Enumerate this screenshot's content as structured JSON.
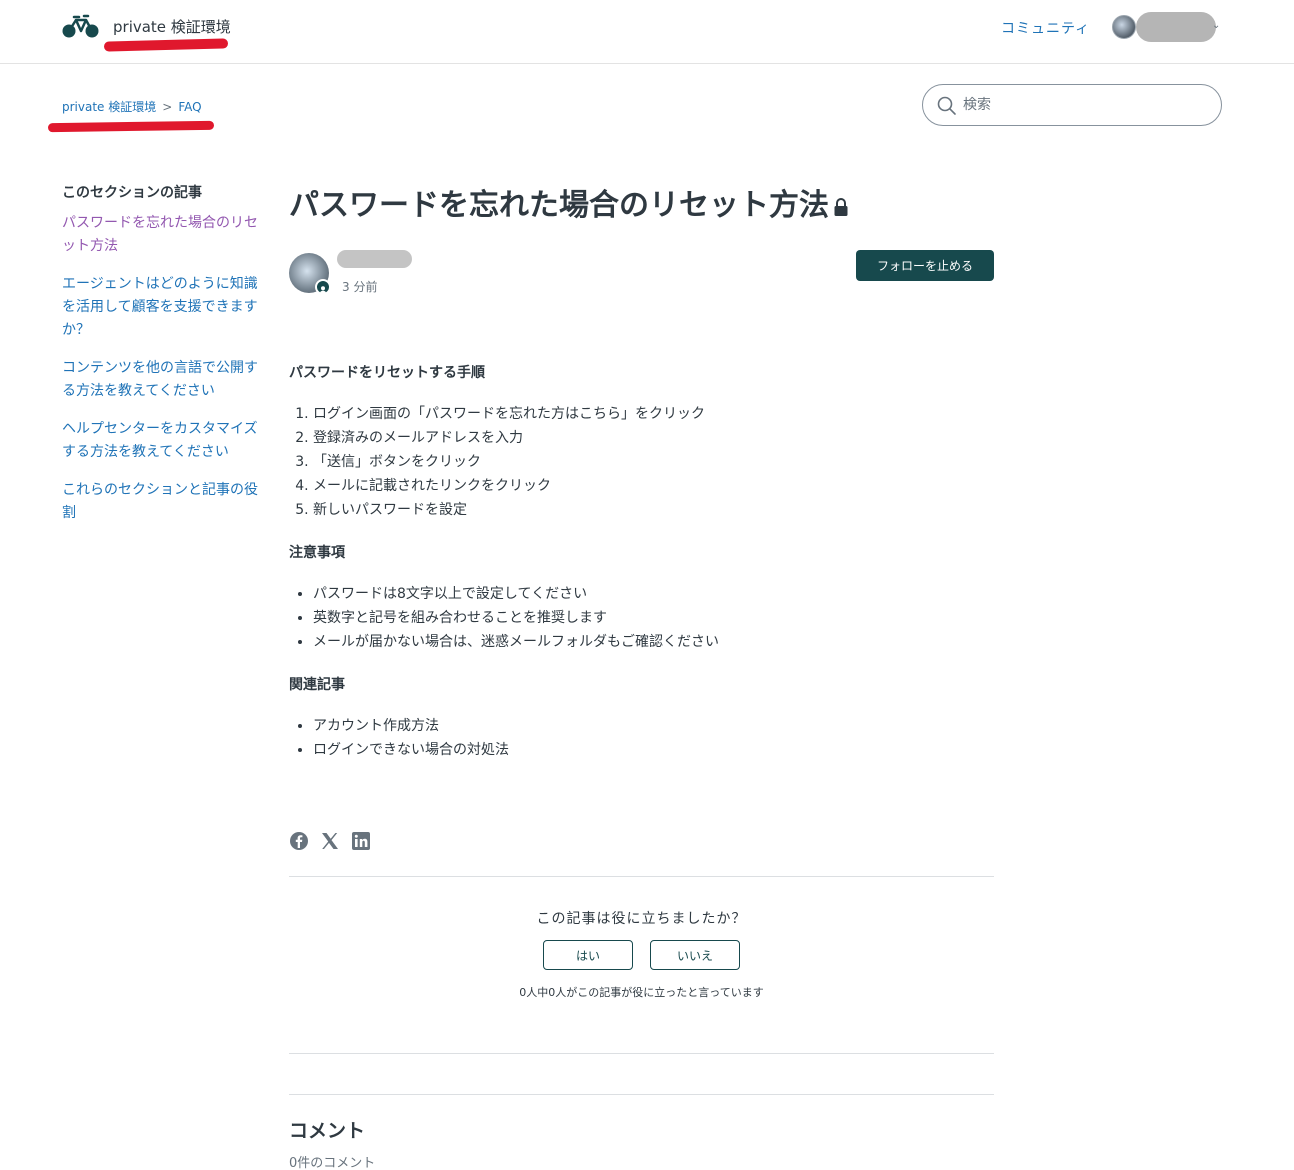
{
  "header": {
    "site_name": "private 検証環境",
    "nav_community": "コミュニティ"
  },
  "breadcrumb": {
    "items": [
      "private 検証環境",
      "FAQ"
    ],
    "separator": ">"
  },
  "search": {
    "placeholder": "検索"
  },
  "sidebar": {
    "heading": "このセクションの記事",
    "items": [
      {
        "label": "パスワードを忘れた場合のリセット方法",
        "current": true
      },
      {
        "label": "エージェントはどのように知識を活用して顧客を支援できますか？"
      },
      {
        "label": "コンテンツを他の言語で公開する方法を教えてください"
      },
      {
        "label": "ヘルプセンターをカスタマイズする方法を教えてください"
      },
      {
        "label": "これらのセクションと記事の役割"
      }
    ]
  },
  "article": {
    "title": "パスワードを忘れた場合のリセット方法",
    "icon_locked": "lock-icon",
    "meta_time": "3 分前",
    "follow_button": "フォローを止める",
    "sections": {
      "steps_heading": "パスワードをリセットする手順",
      "steps": [
        "ログイン画面の「パスワードを忘れた方はこちら」をクリック",
        "登録済みのメールアドレスを入力",
        "「送信」ボタンをクリック",
        "メールに記載されたリンクをクリック",
        "新しいパスワードを設定"
      ],
      "notes_heading": "注意事項",
      "notes": [
        "パスワードは8文字以上で設定してください",
        "英数字と記号を組み合わせることを推奨します",
        "メールが届かない場合は、迷惑メールフォルダもご確認ください"
      ],
      "related_heading": "関連記事",
      "related": [
        "アカウント作成方法",
        "ログインできない場合の対処法"
      ]
    },
    "share_icons": [
      "facebook-icon",
      "x-icon",
      "linkedin-icon"
    ]
  },
  "vote": {
    "question": "この記事は役に立ちましたか？",
    "yes": "はい",
    "no": "いいえ",
    "count_text": "0人中0人がこの記事が役に立ったと言っています"
  },
  "comments": {
    "title": "コメント",
    "count": "0件のコメント"
  },
  "colors": {
    "brand_dark": "#17494d",
    "link": "#1f73b7",
    "visited_link": "#9358b0",
    "redaction_marker": "#e0182d"
  }
}
